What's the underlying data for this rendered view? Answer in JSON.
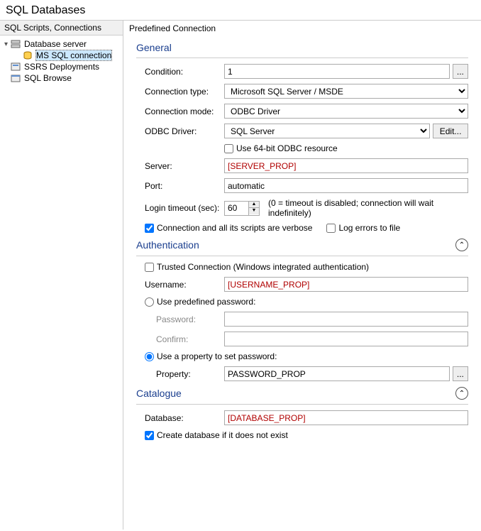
{
  "window": {
    "title": "SQL Databases"
  },
  "sidebar": {
    "header": "SQL Scripts, Connections",
    "items": [
      {
        "label": "Database server"
      },
      {
        "label": "MS SQL connection"
      },
      {
        "label": "SSRS Deployments"
      },
      {
        "label": "SQL Browse"
      }
    ]
  },
  "panel": {
    "header": "Predefined Connection"
  },
  "general": {
    "title": "General",
    "condition_label": "Condition:",
    "condition_value": "1",
    "conn_type_label": "Connection type:",
    "conn_type_value": "Microsoft SQL Server / MSDE",
    "conn_mode_label": "Connection mode:",
    "conn_mode_value": "ODBC Driver",
    "odbc_label": "ODBC Driver:",
    "odbc_value": "SQL Server",
    "edit_btn": "Edit...",
    "use64_label": "Use 64-bit ODBC resource",
    "server_label": "Server:",
    "server_value": "[SERVER_PROP]",
    "port_label": "Port:",
    "port_value": "automatic",
    "timeout_label": "Login timeout (sec):",
    "timeout_value": "60",
    "timeout_hint": "(0 = timeout is disabled; connection will wait indefinitely)",
    "verbose_label": "Connection and all its scripts are verbose",
    "log_label": "Log errors to file"
  },
  "auth": {
    "title": "Authentication",
    "trusted_label": "Trusted Connection (Windows integrated authentication)",
    "username_label": "Username:",
    "username_value": "[USERNAME_PROP]",
    "predef_label": "Use predefined password:",
    "password_label": "Password:",
    "confirm_label": "Confirm:",
    "useprop_label": "Use a property to set password:",
    "property_label": "Property:",
    "property_value": "PASSWORD_PROP"
  },
  "catalogue": {
    "title": "Catalogue",
    "database_label": "Database:",
    "database_value": "[DATABASE_PROP]",
    "create_label": "Create database if it does not exist"
  },
  "misc": {
    "dots": "..."
  }
}
